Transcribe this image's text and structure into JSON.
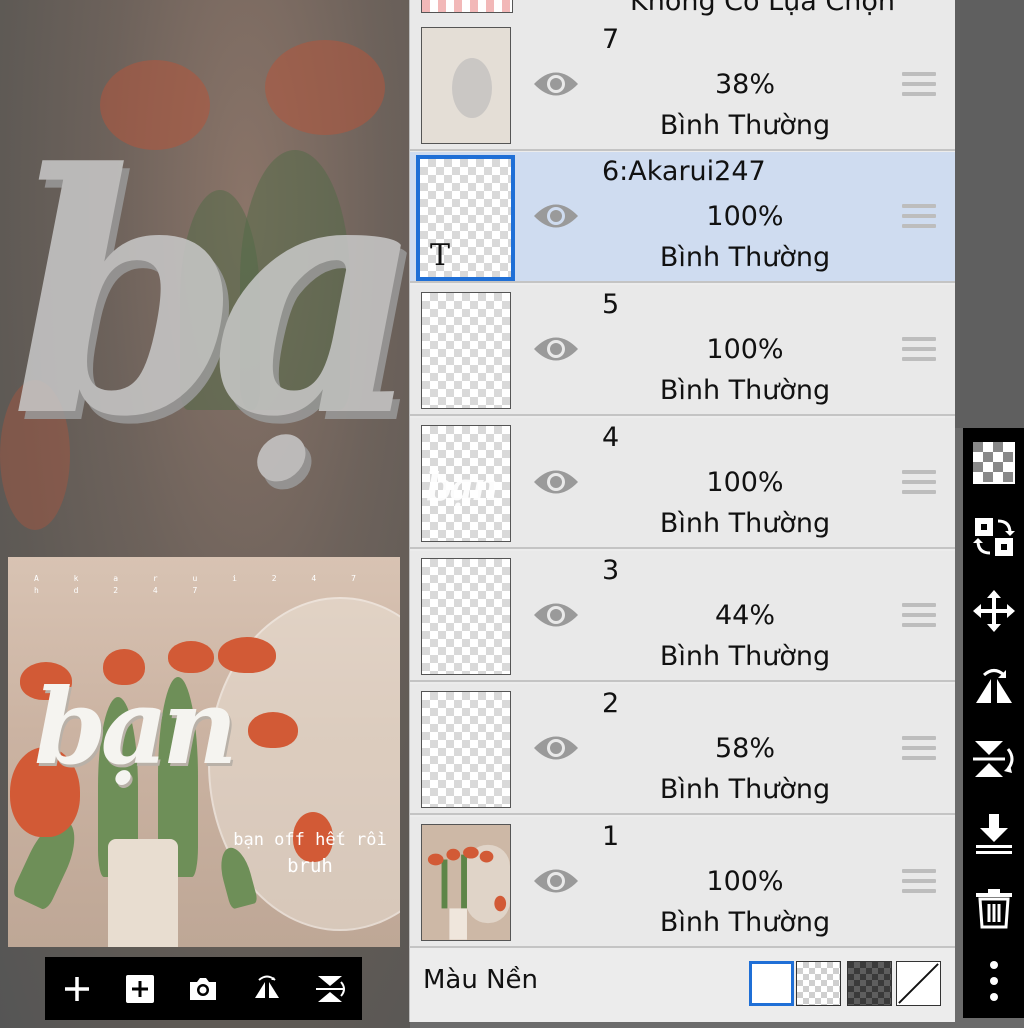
{
  "canvas": {
    "background_word": "bạ",
    "preview": {
      "tiny_text_line1": "A k a r u i 2 4 7",
      "tiny_text_line2": "h d 2 4 7",
      "title_word": "bạn",
      "caption_line1": "bạn off hết rồi",
      "caption_line2": "bruh"
    }
  },
  "bottom_toolbar": {
    "icons": [
      "add-icon",
      "add-layer-icon",
      "camera-icon",
      "flip-horizontal-icon",
      "flip-vertical-icon"
    ]
  },
  "layers_panel": {
    "top_partial_label": "Không Có Lựa Chọn",
    "layers": [
      {
        "name": "7",
        "opacity": "38%",
        "mode": "Bình Thường",
        "selected": false
      },
      {
        "name": "6:Akarui247",
        "opacity": "100%",
        "mode": "Bình Thường",
        "selected": true,
        "type_glyph": "T"
      },
      {
        "name": "5",
        "opacity": "100%",
        "mode": "Bình Thường",
        "selected": false
      },
      {
        "name": "4",
        "opacity": "100%",
        "mode": "Bình Thường",
        "selected": false,
        "thumb_text": "bạn"
      },
      {
        "name": "3",
        "opacity": "44%",
        "mode": "Bình Thường",
        "selected": false
      },
      {
        "name": "2",
        "opacity": "58%",
        "mode": "Bình Thường",
        "selected": false
      },
      {
        "name": "1",
        "opacity": "100%",
        "mode": "Bình Thường",
        "selected": false
      }
    ],
    "background": {
      "label": "Màu Nền",
      "selected_swatch": "white"
    }
  },
  "right_toolbar": {
    "icons": [
      "transparency-icon",
      "swap-layer-icon",
      "move-icon",
      "flip-horizontal-icon",
      "flip-vertical-icon",
      "merge-down-icon",
      "trash-icon",
      "more-icon"
    ]
  },
  "colors": {
    "selection_blue": "#1f6fd6",
    "selected_row": "#cfdcf0",
    "panel_bg": "#ececec"
  }
}
